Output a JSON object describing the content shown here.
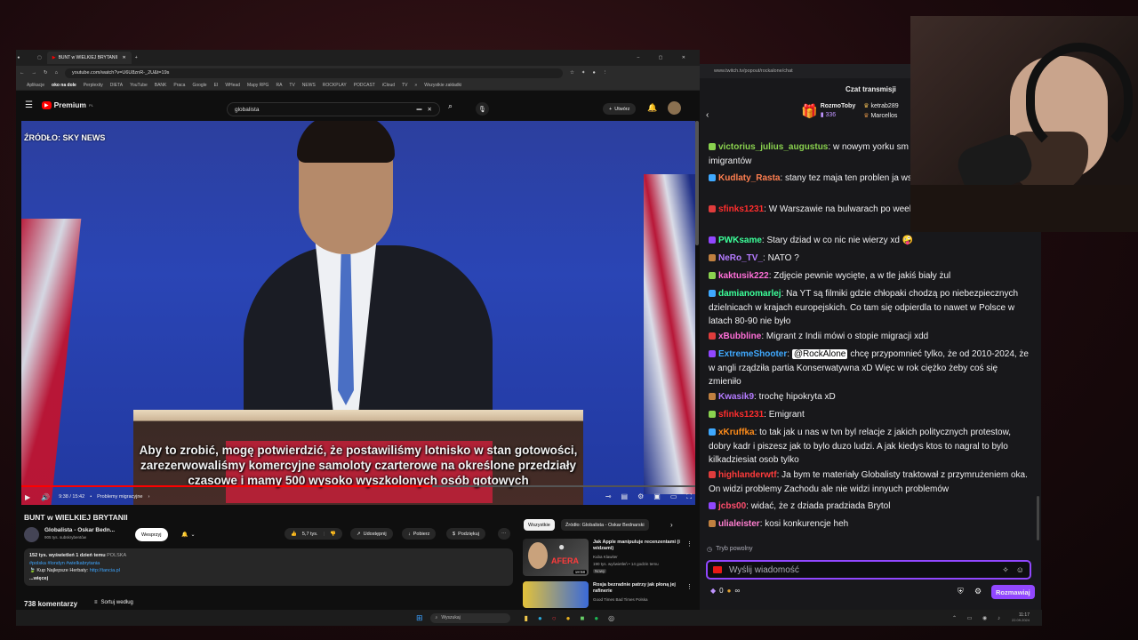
{
  "browser": {
    "tab_title": "BUNT w WIELKIEJ BRYTANII",
    "url": "youtube.com/watch?v=U6U8znR-_2U&t=19s",
    "bookmarks": [
      "Aplikacje",
      "oko na dole",
      "Perplexity",
      "DIETA",
      "YouTube",
      "BANK",
      "Praca",
      "Google",
      "EI",
      "WHead",
      "Mapy RPG",
      "RA",
      "TV",
      "NEWS",
      "ROCKPLAY",
      "PODCAST",
      "iCloud",
      "TV"
    ],
    "bookmarks_all": "Wszystkie zakładki"
  },
  "youtube": {
    "logo": "Premium",
    "logo_sup": "PL",
    "search_value": "globalista",
    "create_label": "Utwórz",
    "video_source": "ŹRÓDŁO: SKY NEWS",
    "subtitle_lines": [
      "Aby to zrobić, mogę potwierdzić, że postawiliśmy lotnisko w stan gotowości,",
      "zarezerwowaliśmy komercyjne samoloty czarterowe na określone przedziały",
      "czasowe i mamy 500 wysoko wyszkolonych osób gotowych"
    ],
    "time": "9:38 / 15:42",
    "chapter": "Problemy migracyjne",
    "progress": 0.61,
    "title": "BUNT w WIELKIEJ BRYTANII",
    "channel": "Globalista - Oskar Bedn...",
    "subs": "905 tys. subskrybentów",
    "support": "Wesprzyj",
    "likes": "5,7 tys.",
    "share": "Udostępnij",
    "download": "Pobierz",
    "thanks": "Podziękuj",
    "desc_views": "152 tys. wyświetleń  1 dzień temu",
    "desc_country": "POLSKA",
    "desc_tags": "#polska #londyn #wielkabrytania",
    "desc_line": "Kup Najlepsze Herbaty:",
    "desc_link": "http://tancia.pl",
    "desc_more": "...więcej",
    "comments": "738 komentarzy",
    "sort": "Sortuj według",
    "chip_all": "Wszystkie",
    "chip_source": "Źródło: Globalista - Oskar Bednarski",
    "recs": [
      {
        "title": "Jak Apple manipuluje recenzentami (i widzami)",
        "channel": "Kuba Klawiter",
        "meta": "190 tys. wyświetleń • 14 godzin temu",
        "badge": "Nowy",
        "duration": "18:58",
        "thumb_text": "AFERA"
      },
      {
        "title": "Rosja bezradnie patrzy jak płoną jej rafinerie",
        "channel": "Good Times Bad Times Polska",
        "meta": "",
        "badge": "",
        "duration": "",
        "thumb_text": ""
      }
    ]
  },
  "chat": {
    "url": "www.twitch.tv/popout/rockalone/chat",
    "header": "Czat transmisji",
    "top_gifter": "RozmoToby",
    "top_count": "336",
    "top_users": [
      "ketrab289",
      "Marcellos"
    ],
    "messages": [
      {
        "user": "victorius_julius_augustus",
        "color": "#8ad24f",
        "text": "w nowym yorku sm leżą i to nie jest kwestia imigrantów"
      },
      {
        "user": "Kudlaty_Rasta",
        "color": "#ff7f50",
        "text": "stany tez maja ten problen ja wszedzie"
      },
      {
        "user": "sfinks1231",
        "color": "#ff2d2d",
        "text": "W Warszawie na bulwarach po weekendowych też tak jest"
      },
      {
        "user": "PWKsame",
        "color": "#3cff9a",
        "text": "Stary dziad w co nic nie wierzy xd 🤪"
      },
      {
        "user": "NeRo_TV_",
        "color": "#b47bff",
        "text": "NATO ?"
      },
      {
        "user": "kaktusik222",
        "color": "#ff6fd8",
        "text": "Zdjęcie pewnie wycięte, a w tle jakiś biały żul"
      },
      {
        "user": "damianomarlej",
        "color": "#3cff9a",
        "text": "Na YT są filmiki gdzie chłopaki chodzą po niebezpiecznych dzielnicach w krajach europejskich. Co tam się odpierdla to nawet w Polsce w latach 80-90 nie było"
      },
      {
        "user": "xBubbline",
        "color": "#ff6fd8",
        "text": "Migrant z Indii mówi o stopie migracji xdd"
      },
      {
        "user": "ExtremeShooter",
        "color": "#3fa9ff",
        "mention": "@RockAlone",
        "text": "chcę przypomnieć tylko, że od 2010-2024, że w angli rządziła partia Konserwatywna xD Więc w rok ciężko żeby coś się zmieniło"
      },
      {
        "user": "Kwasik9",
        "color": "#b47bff",
        "text": "trochę hipokryta xD"
      },
      {
        "user": "sfinks1231",
        "color": "#ff2d2d",
        "text": "Emigrant"
      },
      {
        "user": "xKruffka",
        "color": "#ff8c1a",
        "text": "to tak jak u nas w tvn byl relacje z jakich politycznych protestow, dobry kadr i piszesz jak to bylo duzo ludzi. A jak kiedys ktos to nagral to bylo kilkadziesiat osob tylko"
      },
      {
        "user": "highlanderwtf",
        "color": "#ff3b3b",
        "text": "Ja bym te materiały Globalisty traktował z przymrużeniem oka. On widzi problemy Zachodu ale nie widzi innyuch problemów"
      },
      {
        "user": "jcbs00",
        "color": "#ff4d6d",
        "text": "widać, że z dziada pradziada Brytol"
      },
      {
        "user": "ulialeister",
        "color": "#ff7fd0",
        "text": "kosi konkurencje heh"
      }
    ],
    "slow_mode": "Tryb powolny",
    "input_placeholder": "Wyślij wiadomość",
    "points": "0",
    "chat_button": "Rozmawiaj"
  },
  "taskbar": {
    "search": "Wyszukaj",
    "time": "11:17",
    "date": "22.09.2024"
  },
  "colors": {
    "yt_red": "#ff0000",
    "twitch_purple": "#9147ff",
    "twitch_bg": "#18181b"
  }
}
